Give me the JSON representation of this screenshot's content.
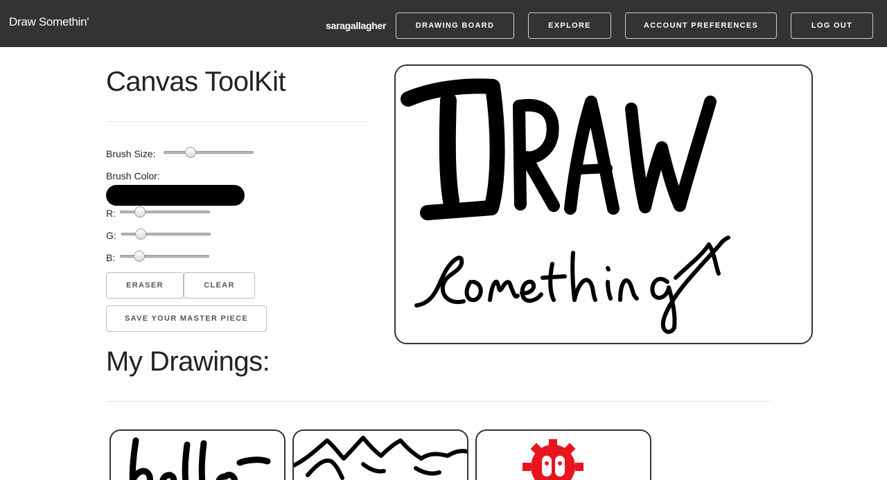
{
  "app": {
    "brand": "Draw Somethin'",
    "username": "saragallagher"
  },
  "nav": {
    "drawing_board": "DRAWING BOARD",
    "explore": "EXPLORE",
    "account_preferences": "ACCOUNT PREFERENCES",
    "log_out": "LOG OUT"
  },
  "toolkit": {
    "title": "Canvas ToolKit",
    "brush_size_label": "Brush Size:",
    "brush_size_value": 0.27,
    "brush_color_label": "Brush Color:",
    "brush_color": "#000000",
    "r_label": "R:",
    "r_value": 0.18,
    "g_label": "G:",
    "g_value": 0.18,
    "b_label": "B:",
    "b_value": 0.18,
    "eraser_label": "ERASER",
    "clear_label": "CLEAR",
    "save_label": "SAVE YOUR MASTER PIECE"
  },
  "drawings": {
    "title": "My Drawings:",
    "items": [
      {
        "name": "hello"
      },
      {
        "name": "mountains"
      },
      {
        "name": "red-gear"
      }
    ]
  },
  "colors": {
    "navbar": "#333333",
    "accent_red": "#e8141e"
  }
}
